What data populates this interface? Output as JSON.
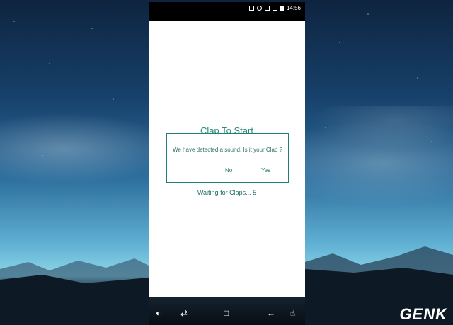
{
  "status_bar": {
    "time": "14:56"
  },
  "app": {
    "title": "Clap To Start",
    "waiting_text": "Waiting for Claps... 5"
  },
  "dialog": {
    "message": "We have detected a sound. Is it your Clap ?",
    "no_label": "No",
    "yes_label": "Yes"
  },
  "navbar": {
    "icons": [
      "screen-off-icon",
      "recent-apps-icon",
      "home-icon",
      "back-icon",
      "gesture-icon"
    ]
  },
  "branding": {
    "logo": "GENK"
  },
  "colors": {
    "accent": "#2a8a7a",
    "dialog_border": "#1f7f74"
  }
}
